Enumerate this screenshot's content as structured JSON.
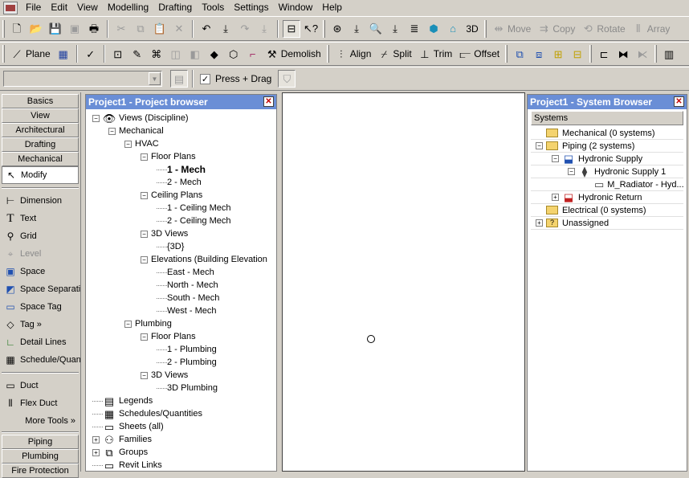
{
  "menu": [
    "File",
    "Edit",
    "View",
    "Modelling",
    "Drafting",
    "Tools",
    "Settings",
    "Window",
    "Help"
  ],
  "toolbar1": {
    "threed_label": "3D",
    "move": "Move",
    "copy": "Copy",
    "rotate": "Rotate",
    "array": "Array"
  },
  "toolbar2": {
    "plane": "Plane",
    "demolish": "Demolish",
    "align": "Align",
    "split": "Split",
    "trim": "Trim",
    "offset": "Offset"
  },
  "options_bar": {
    "press_drag": "Press + Drag",
    "press_drag_checked": true
  },
  "design_bar": {
    "tabs_top": [
      "Basics",
      "View",
      "Architectural",
      "Drafting",
      "Mechanical"
    ],
    "modify": "Modify",
    "tools": [
      {
        "label": "Dimension",
        "icon": "dimension-icon",
        "disabled": false
      },
      {
        "label": "Text",
        "icon": "text-icon",
        "disabled": false
      },
      {
        "label": "Grid",
        "icon": "grid-icon",
        "disabled": false
      },
      {
        "label": "Level",
        "icon": "level-icon",
        "disabled": true
      },
      {
        "label": "Space",
        "icon": "space-icon",
        "disabled": false
      },
      {
        "label": "Space Separati",
        "icon": "space-separation-icon",
        "disabled": false
      },
      {
        "label": "Space Tag",
        "icon": "space-tag-icon",
        "disabled": false
      },
      {
        "label": "Tag »",
        "icon": "tag-icon",
        "disabled": false
      },
      {
        "label": "Detail Lines",
        "icon": "detail-lines-icon",
        "disabled": false
      },
      {
        "label": "Schedule/Quan",
        "icon": "schedule-icon",
        "disabled": false
      }
    ],
    "duct": "Duct",
    "flex_duct": "Flex Duct",
    "more_tools": "More Tools »",
    "tabs_bottom": [
      "Piping",
      "Plumbing",
      "Fire Protection"
    ]
  },
  "project_browser": {
    "title": "Project1 - Project browser",
    "items": [
      {
        "label": "Views (Discipline)",
        "bold": false
      },
      {
        "label": "Mechanical",
        "bold": false
      },
      {
        "label": "HVAC",
        "bold": false
      },
      {
        "label": "Floor Plans",
        "bold": false
      },
      {
        "label": "1 - Mech",
        "bold": true
      },
      {
        "label": "2 - Mech",
        "bold": false
      },
      {
        "label": "Ceiling Plans",
        "bold": false
      },
      {
        "label": "1 - Ceiling Mech",
        "bold": false
      },
      {
        "label": "2 - Ceiling Mech",
        "bold": false
      },
      {
        "label": "3D Views",
        "bold": false
      },
      {
        "label": "{3D}",
        "bold": false
      },
      {
        "label": "Elevations (Building Elevation",
        "bold": false
      },
      {
        "label": "East - Mech",
        "bold": false
      },
      {
        "label": "North - Mech",
        "bold": false
      },
      {
        "label": "South - Mech",
        "bold": false
      },
      {
        "label": "West - Mech",
        "bold": false
      },
      {
        "label": "Plumbing",
        "bold": false
      },
      {
        "label": "Floor Plans",
        "bold": false
      },
      {
        "label": "1 - Plumbing",
        "bold": false
      },
      {
        "label": "2 - Plumbing",
        "bold": false
      },
      {
        "label": "3D Views",
        "bold": false
      },
      {
        "label": "3D Plumbing",
        "bold": false
      },
      {
        "label": "Legends",
        "bold": false
      },
      {
        "label": "Schedules/Quantities",
        "bold": false
      },
      {
        "label": "Sheets (all)",
        "bold": false
      },
      {
        "label": "Families",
        "bold": false
      },
      {
        "label": "Groups",
        "bold": false
      },
      {
        "label": "Revit Links",
        "bold": false
      }
    ]
  },
  "system_browser": {
    "title": "Project1 - System Browser",
    "header": "Systems",
    "items": [
      {
        "label": "Mechanical (0 systems)"
      },
      {
        "label": "Piping (2 systems)"
      },
      {
        "label": "Hydronic Supply"
      },
      {
        "label": "Hydronic Supply 1"
      },
      {
        "label": "M_Radiator - Hyd..."
      },
      {
        "label": "Hydronic Return"
      },
      {
        "label": "Electrical (0 systems)"
      },
      {
        "label": "Unassigned"
      }
    ]
  },
  "colors": {
    "title_bar": "#6a8ed6",
    "face": "#d4d0c8"
  }
}
